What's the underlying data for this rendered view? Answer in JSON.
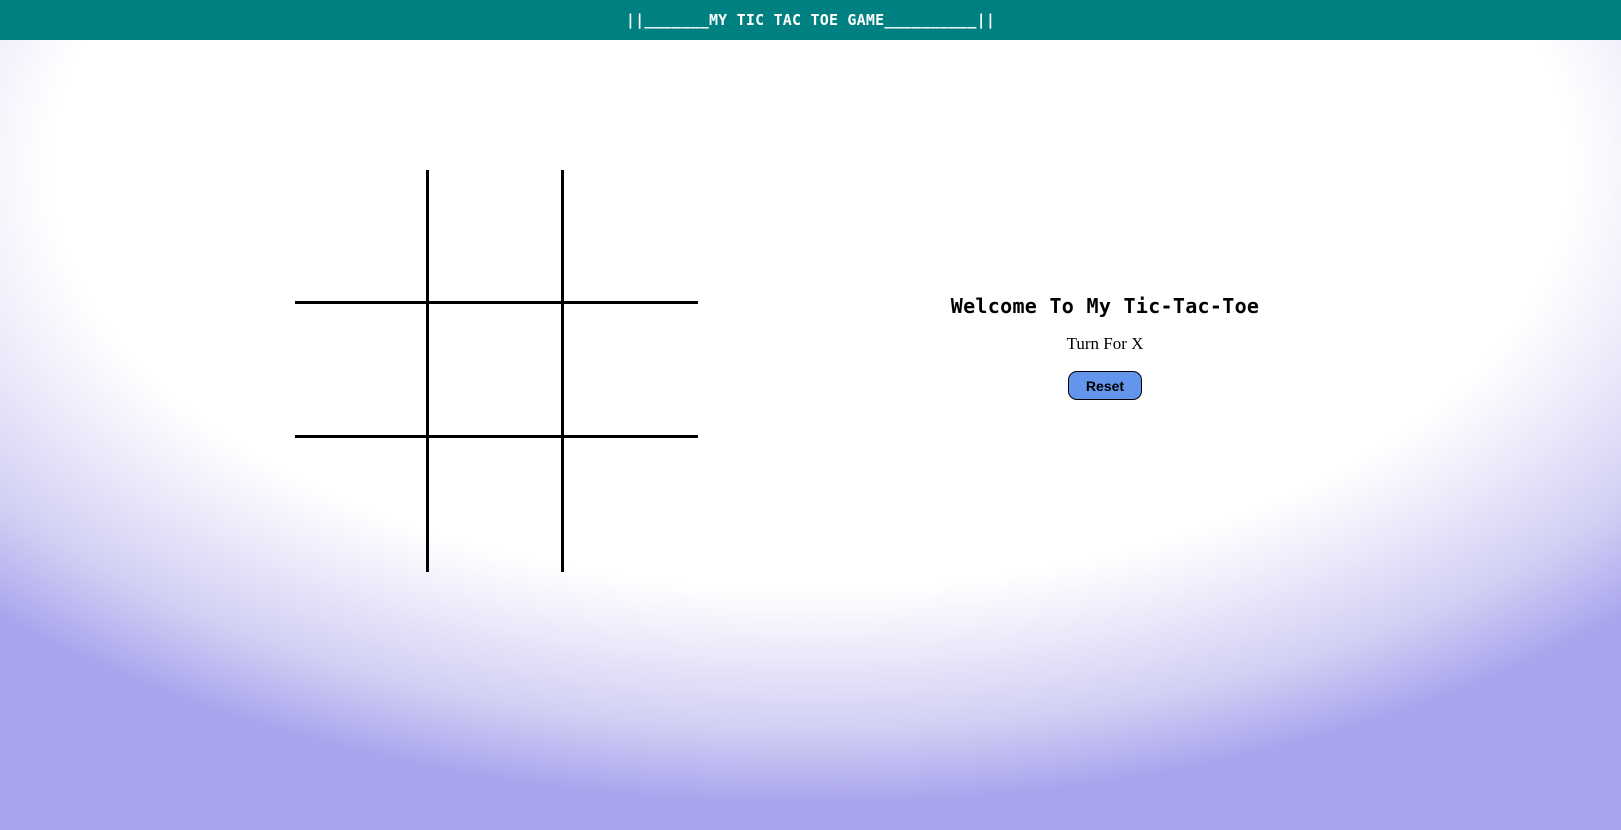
{
  "header": {
    "title": "||_______MY TIC TAC TOE GAME__________||"
  },
  "board": {
    "cells": [
      "",
      "",
      "",
      "",
      "",
      "",
      "",
      "",
      ""
    ]
  },
  "info": {
    "welcome": "Welcome To My Tic-Tac-Toe",
    "turn_text": "Turn For X",
    "reset_label": "Reset"
  },
  "colors": {
    "header_bg": "#008080",
    "reset_bg": "#6495ed",
    "gradient_bottom": "#a8a4ee"
  }
}
